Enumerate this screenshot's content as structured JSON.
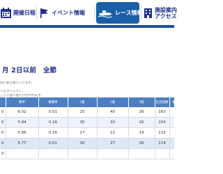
{
  "nav": {
    "items": [
      {
        "label": "開催日程",
        "icon": "calendar-icon"
      },
      {
        "label": "イベント情報",
        "icon": "flag-icon"
      },
      {
        "label": "レース情報",
        "icon": "boat-icon",
        "active": true
      },
      {
        "label_line1": "施設案内",
        "label_line2": "アクセス",
        "icon": "building-icon"
      }
    ],
    "colors": {
      "text": "#1f2e8c",
      "active_bg": "#1a5fa8",
      "underline": "#1a4f9c"
    }
  },
  "title": "月 2日以前　全節",
  "notes": [
    "別に並び替えできます。",
    "",
    "ンをクリックし、",
    "ごとに並べ替えが行われます。"
  ],
  "table": {
    "header_color": "#4d7ec1",
    "headers": [
      "",
      "勝率",
      "複勝率",
      "1着",
      "2着",
      "3着",
      "出走回数",
      "優"
    ],
    "rows": [
      [
        "0",
        "6.02",
        "0.01",
        "25",
        "40",
        "26",
        "163",
        ""
      ],
      [
        "0",
        "5.84",
        "0.16",
        "30",
        "30",
        "26",
        "154",
        ""
      ],
      [
        "0",
        "5.86",
        "0.26",
        "27",
        "12",
        "19",
        "132",
        ""
      ],
      [
        "0",
        "5.77",
        "0.01",
        "30",
        "27",
        "26",
        "174",
        ""
      ],
      [
        "0",
        "",
        "",
        "",
        "",
        "",
        "",
        ""
      ]
    ]
  }
}
